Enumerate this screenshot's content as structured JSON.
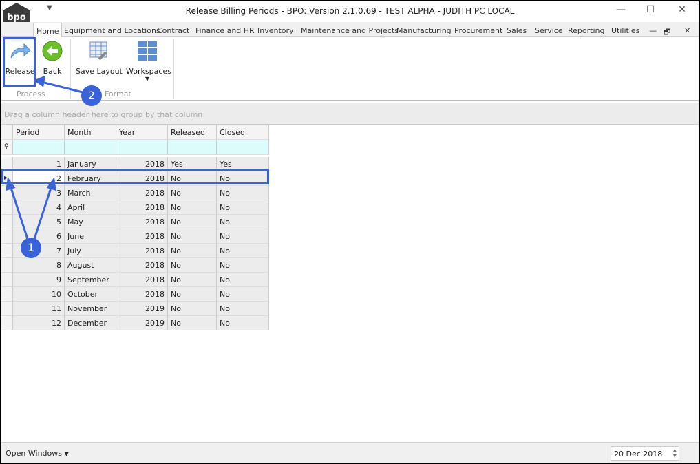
{
  "window": {
    "title": "Release Billing Periods - BPO: Version 2.1.0.69 - TEST ALPHA - JUDITH PC LOCAL",
    "logo": "bpo",
    "qat_icon": "dropdown-arrow"
  },
  "tabs": [
    "Home",
    "Equipment and Locations",
    "Contract",
    "Finance and HR",
    "Inventory",
    "Maintenance and Projects",
    "Manufacturing",
    "Procurement",
    "Sales",
    "Service",
    "Reporting",
    "Utilities"
  ],
  "ribbon": {
    "release": "Release",
    "back": "Back",
    "save_layout": "Save Layout",
    "workspaces": "Workspaces",
    "group_process": "Process",
    "group_format": "Format"
  },
  "grid": {
    "group_hint": "Drag a column header here to group by that column",
    "columns": [
      "Period",
      "Month",
      "Year",
      "Released",
      "Closed"
    ],
    "rows": [
      [
        "1",
        "January",
        "2018",
        "Yes",
        "Yes"
      ],
      [
        "2",
        "February",
        "2018",
        "No",
        "No"
      ],
      [
        "3",
        "March",
        "2018",
        "No",
        "No"
      ],
      [
        "4",
        "April",
        "2018",
        "No",
        "No"
      ],
      [
        "5",
        "May",
        "2018",
        "No",
        "No"
      ],
      [
        "6",
        "June",
        "2018",
        "No",
        "No"
      ],
      [
        "7",
        "July",
        "2018",
        "No",
        "No"
      ],
      [
        "8",
        "August",
        "2018",
        "No",
        "No"
      ],
      [
        "9",
        "September",
        "2018",
        "No",
        "No"
      ],
      [
        "10",
        "October",
        "2018",
        "No",
        "No"
      ],
      [
        "11",
        "November",
        "2019",
        "No",
        "No"
      ],
      [
        "12",
        "December",
        "2019",
        "No",
        "No"
      ]
    ],
    "selected_row": 1
  },
  "status": {
    "open_windows": "Open Windows",
    "date": "20 Dec 2018"
  },
  "annotations": [
    "1",
    "2"
  ],
  "colors": {
    "accent": "#3a62d9",
    "filter_row": "#dcfbfb"
  }
}
